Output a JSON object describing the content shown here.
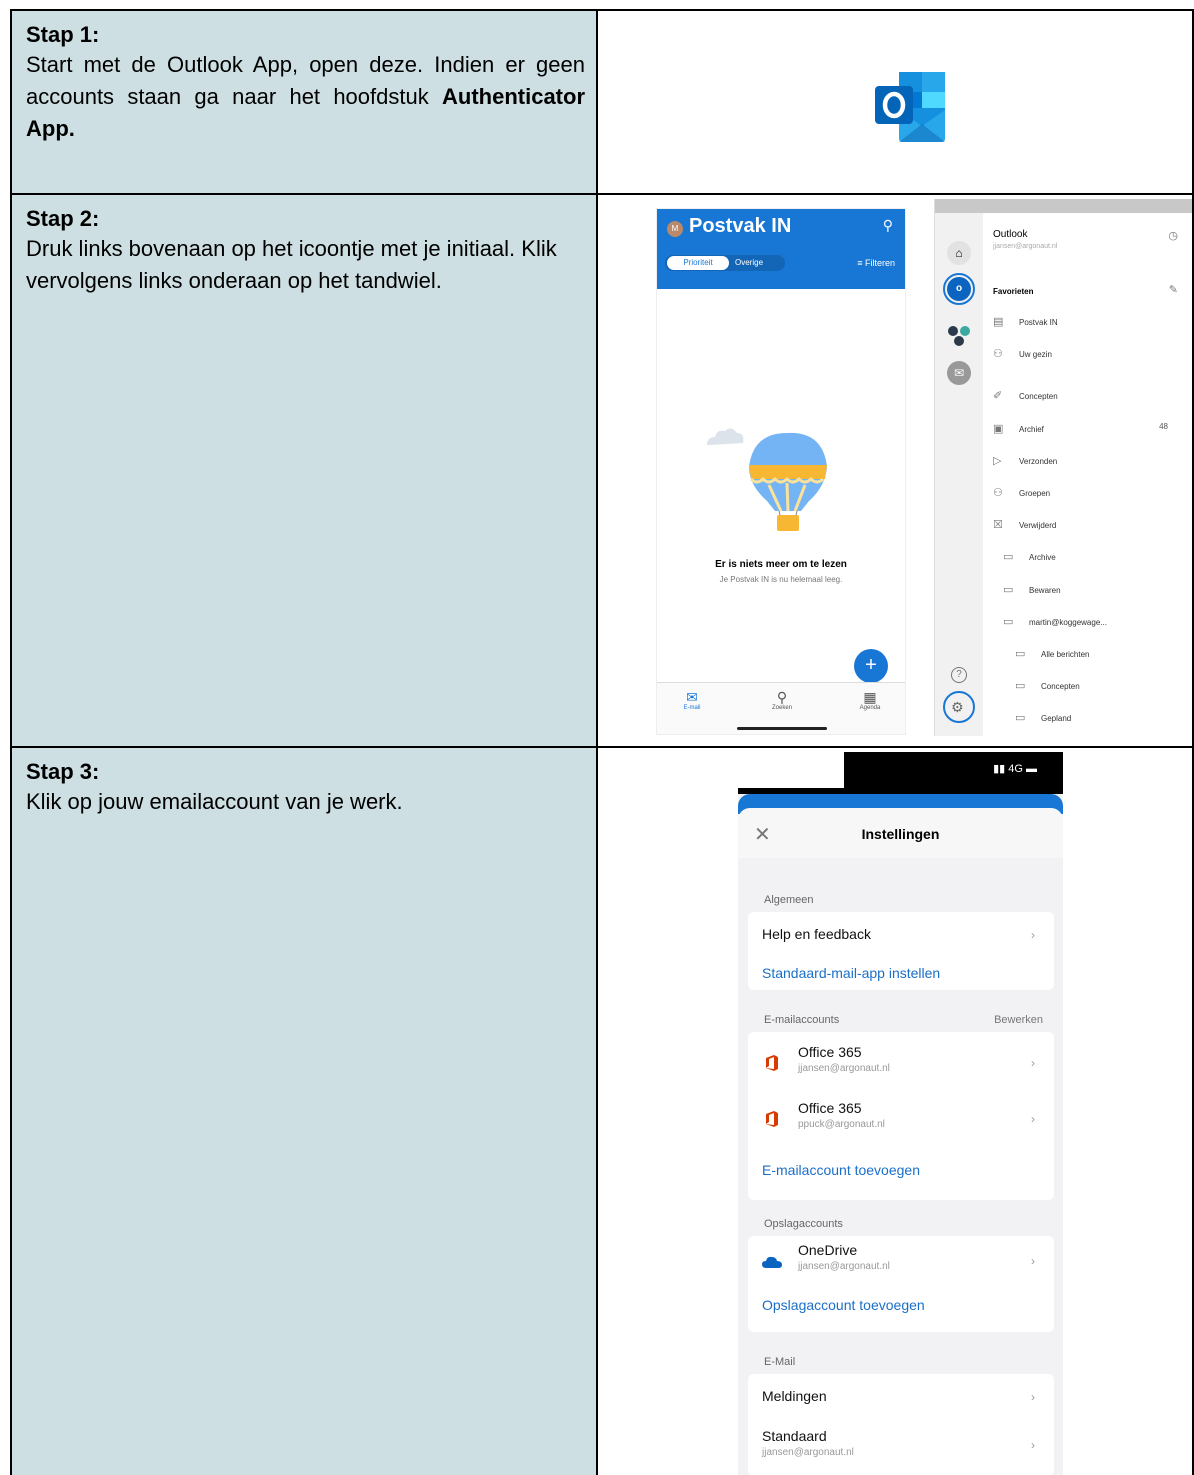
{
  "steps": [
    {
      "title": "Stap 1:",
      "text_before": "Start met de Outlook App, open deze. Indien er geen accounts staan ga naar het hoofdstuk ",
      "text_bold": "Authenticator App."
    },
    {
      "title": "Stap 2:",
      "text": "Druk links bovenaan op het icoontje met je initiaal. Klik vervolgens links onderaan op het tandwiel."
    },
    {
      "title": "Stap 3:",
      "text": "Klik op jouw emailaccount van je werk."
    }
  ],
  "step2_inbox": {
    "avatar_letter": "M",
    "title": "Postvak IN",
    "tab_active": "Prioriteit",
    "tab_other": "Overige",
    "filter": "Filteren",
    "empty_title": "Er is niets meer om te lezen",
    "empty_sub": "Je Postvak IN is nu helemaal leeg.",
    "tabs": [
      "E-mail",
      "Zoeken",
      "Agenda"
    ]
  },
  "step2_menu": {
    "account_name": "Outlook",
    "account_email": "jjansen@argonaut.nl",
    "favorites": "Favorieten",
    "folders": [
      {
        "label": "Postvak IN",
        "indent": 0,
        "icon": "inbox-icon"
      },
      {
        "label": "Uw gezin",
        "indent": 0,
        "icon": "people-icon"
      },
      {
        "label": "Concepten",
        "indent": 0,
        "icon": "draft-icon"
      },
      {
        "label": "Archief",
        "indent": 0,
        "icon": "archive-icon",
        "count": "48"
      },
      {
        "label": "Verzonden",
        "indent": 0,
        "icon": "send-icon"
      },
      {
        "label": "Groepen",
        "indent": 0,
        "icon": "people-icon"
      },
      {
        "label": "Verwijderd",
        "indent": 0,
        "icon": "trash-icon"
      },
      {
        "label": "Archive",
        "indent": 1,
        "icon": "folder-icon"
      },
      {
        "label": "Bewaren",
        "indent": 1,
        "icon": "folder-icon"
      },
      {
        "label": "martin@koggewage...",
        "indent": 1,
        "icon": "folder-icon"
      },
      {
        "label": "Alle berichten",
        "indent": 2,
        "icon": "folder-icon"
      },
      {
        "label": "Concepten",
        "indent": 2,
        "icon": "folder-icon"
      },
      {
        "label": "Gepland",
        "indent": 2,
        "icon": "folder-icon"
      }
    ]
  },
  "step3_settings": {
    "status_right": "4G",
    "title": "Instellingen",
    "general": {
      "header": "Algemeen",
      "help": "Help en feedback",
      "default_app": "Standaard-mail-app instellen"
    },
    "email_accounts": {
      "header": "E-mailaccounts",
      "edit": "Bewerken",
      "accounts": [
        {
          "name": "Office 365",
          "email": "jjansen@argonaut.nl"
        },
        {
          "name": "Office 365",
          "email": "ppuck@argonaut.nl"
        }
      ],
      "add": "E-mailaccount toevoegen"
    },
    "storage_accounts": {
      "header": "Opslagaccounts",
      "name": "OneDrive",
      "email": "jjansen@argonaut.nl",
      "add": "Opslagaccount toevoegen"
    },
    "mail": {
      "header": "E-Mail",
      "notifications": "Meldingen",
      "default_label": "Standaard",
      "default_email": "jjansen@argonaut.nl"
    }
  },
  "colors": {
    "cell_bg": "#cddfe2",
    "outlook_blue": "#1877d4",
    "link_blue": "#1a6fc9"
  }
}
